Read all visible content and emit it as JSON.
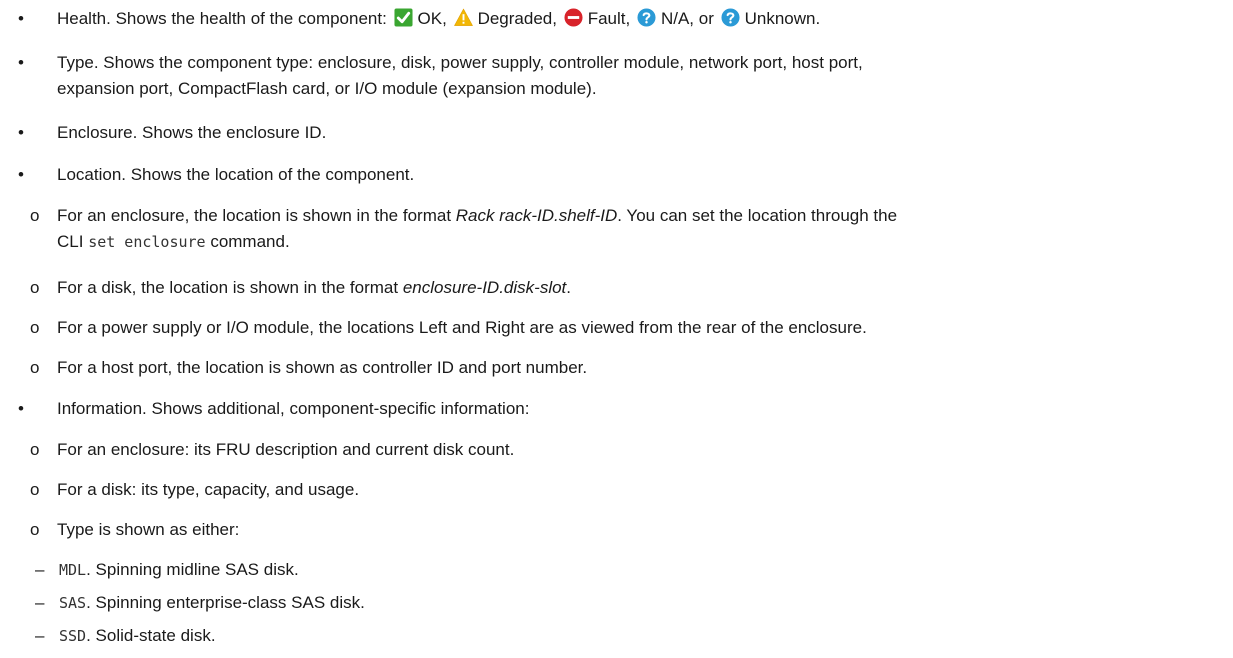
{
  "bullets": {
    "dot": "•",
    "circle": "o",
    "dash": "–"
  },
  "health": {
    "prefix": "Health. Shows the health of the component: ",
    "ok": "OK,",
    "degraded": "Degraded,",
    "fault": "Fault,",
    "na": "N/A, or",
    "unknown": "Unknown.",
    "colors": {
      "ok": "#3aa631",
      "degraded": "#f2b705",
      "fault": "#d8232a",
      "info": "#2b9ad6"
    }
  },
  "type": {
    "line1": "Type. Shows the component type: enclosure, disk, power supply, controller module, network port, host port,",
    "line2": "expansion port, CompactFlash card, or I/O module (expansion module)."
  },
  "enclosure": {
    "text": "Enclosure. Shows the enclosure ID."
  },
  "location": {
    "text": "Location. Shows the location of the component.",
    "items": {
      "enclosure_a": "For an enclosure, the location is shown in the format ",
      "enclosure_b": "Rack rack-ID.shelf-ID",
      "enclosure_c": ". You can set the location through the",
      "enclosure_d": "CLI ",
      "enclosure_e": "set enclosure",
      "enclosure_f": " command.",
      "disk_a": "For a disk, the location is shown in the format ",
      "disk_b": "enclosure-ID.disk-slot",
      "disk_c": ".",
      "power": "For a power supply or I/O module, the locations Left and Right are as viewed from the rear of the enclosure.",
      "host": "For a host port, the location is shown as controller ID and port number."
    }
  },
  "information": {
    "text": "Information. Shows additional, component-specific information:",
    "enclosure": "For an enclosure: its FRU description and current disk count.",
    "disk": "For a disk: its type, capacity, and usage.",
    "type_intro": "Type is shown as either:",
    "types": [
      {
        "code": "MDL",
        "desc": ". Spinning midline SAS disk."
      },
      {
        "code": "SAS",
        "desc": ". Spinning enterprise-class SAS disk."
      },
      {
        "code": "SSD",
        "desc": ". Solid-state disk."
      }
    ]
  }
}
